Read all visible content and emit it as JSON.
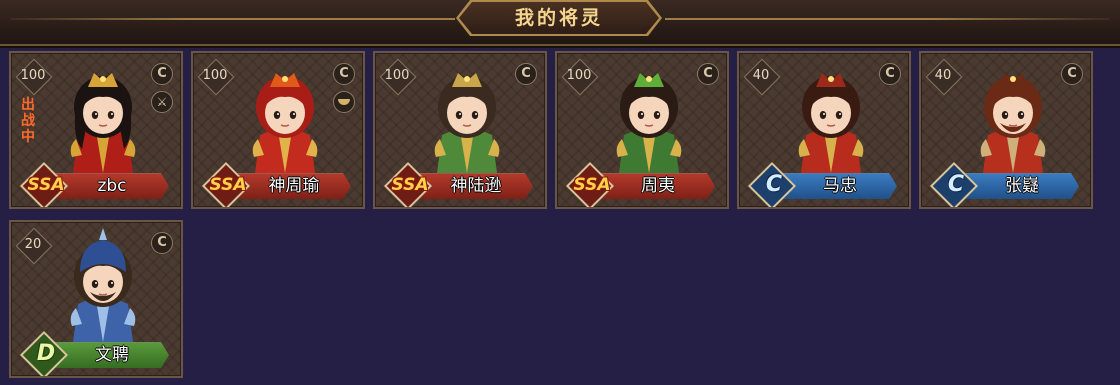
{
  "header": {
    "title": "我的将灵"
  },
  "colors": {
    "background": "#251f46",
    "ssr_plate": "#b33a2a",
    "s_plate": "#3b7bc0",
    "a_plate": "#5a9a3a",
    "title_text": "#f6d58f"
  },
  "cards": [
    {
      "name": "zbc",
      "level": "100",
      "grade": "SSA",
      "plate": "red",
      "status": "出战中",
      "icons": [
        "c-icon",
        "sword-icon"
      ],
      "c": "C",
      "side": "⚔",
      "palette": {
        "hair": "#1b1212",
        "robe": "#b01f17",
        "trim": "#d6a437",
        "crown": "#d6a437"
      }
    },
    {
      "name": "神周瑜",
      "level": "100",
      "grade": "SSA",
      "plate": "red",
      "icons": [
        "c-icon",
        "ingot-icon"
      ],
      "c": "C",
      "palette": {
        "hair": "#a81e16",
        "robe": "#c22b1d",
        "trim": "#e1b24a",
        "crown": "#e05a1a"
      }
    },
    {
      "name": "神陆逊",
      "level": "100",
      "grade": "SSA",
      "plate": "red",
      "icons": [
        "c-icon"
      ],
      "c": "C",
      "palette": {
        "hair": "#3a2a20",
        "robe": "#4f8a3a",
        "trim": "#d8b24a",
        "crown": "#c9a64a"
      }
    },
    {
      "name": "周夷",
      "level": "100",
      "grade": "SSA",
      "plate": "red",
      "icons": [
        "c-icon"
      ],
      "c": "C",
      "palette": {
        "hair": "#2a1b14",
        "robe": "#3f7a33",
        "trim": "#d8b24a",
        "crown": "#5fae3a"
      }
    },
    {
      "name": "马忠",
      "level": "40",
      "grade": "C",
      "plate": "blue",
      "icons": [
        "c-icon"
      ],
      "c": "C",
      "palette": {
        "hair": "#3a1b12",
        "robe": "#b72c1c",
        "trim": "#d7b24c",
        "crown": "#9b2a1c"
      }
    },
    {
      "name": "张嶷",
      "level": "40",
      "grade": "C",
      "plate": "blue",
      "icons": [
        "c-icon"
      ],
      "c": "C",
      "palette": {
        "hair": "#6b2a16",
        "robe": "#b7301e",
        "trim": "#cdb07a",
        "crown": "#6b2a16"
      }
    },
    {
      "name": "文聘",
      "level": "20",
      "grade": "D",
      "plate": "green",
      "icons": [
        "c-icon"
      ],
      "c": "C",
      "palette": {
        "hair": "#3a2a1c",
        "robe": "#3e63a8",
        "trim": "#9fc0e6",
        "crown": "#2f4f95"
      }
    }
  ]
}
